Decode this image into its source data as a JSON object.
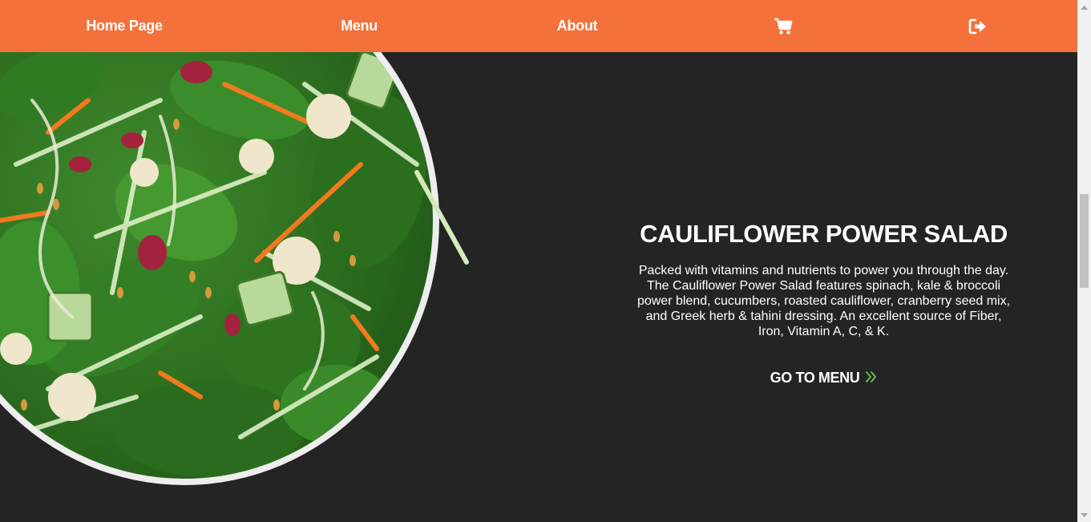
{
  "nav": {
    "home": "Home Page",
    "menu": "Menu",
    "about": "About",
    "cart_icon": "shopping-cart-icon",
    "logout_icon": "sign-out-icon"
  },
  "hero": {
    "title": "CAULIFLOWER POWER SALAD",
    "description": "Packed with vitamins and nutrients to power you through the day. The Cauliflower Power Salad features spinach, kale & broccoli power blend, cucumbers, roasted cauliflower, cranberry seed mix, and Greek herb & tahini dressing. An excellent source of Fiber, Iron, Vitamin A, C, & K.",
    "cta": "GO TO MENU",
    "cta_icon": "double-chevron-right-icon"
  },
  "colors": {
    "nav_bg": "#f4713b",
    "page_bg": "#242424",
    "accent": "#6cbf4f"
  }
}
